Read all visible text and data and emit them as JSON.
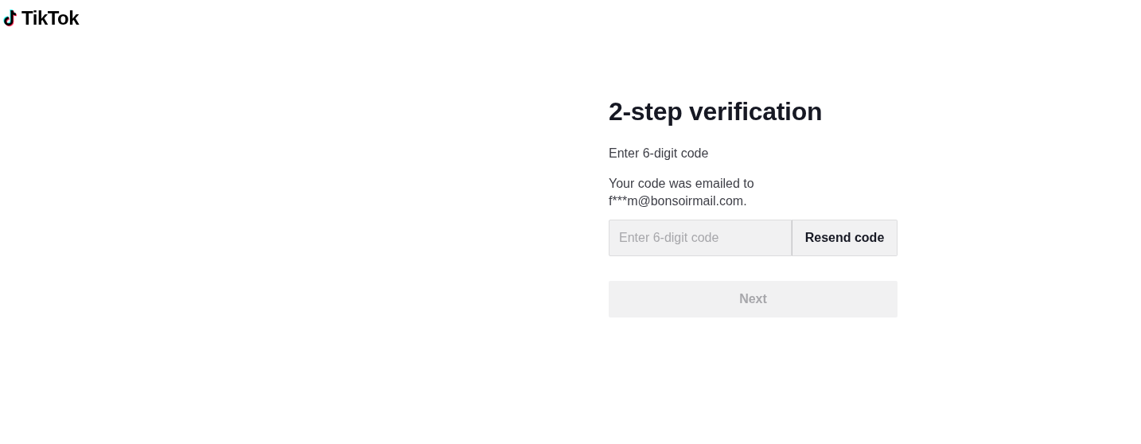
{
  "logo": {
    "text": "TikTok"
  },
  "title": "2-step verification",
  "subtitle": "Enter 6-digit code",
  "message": "Your code was emailed to f***m@bonsoirmail.com.",
  "code_field": {
    "placeholder": "Enter 6-digit code"
  },
  "resend_button": {
    "label": "Resend code"
  },
  "next_button": {
    "label": "Next",
    "disabled": true
  }
}
